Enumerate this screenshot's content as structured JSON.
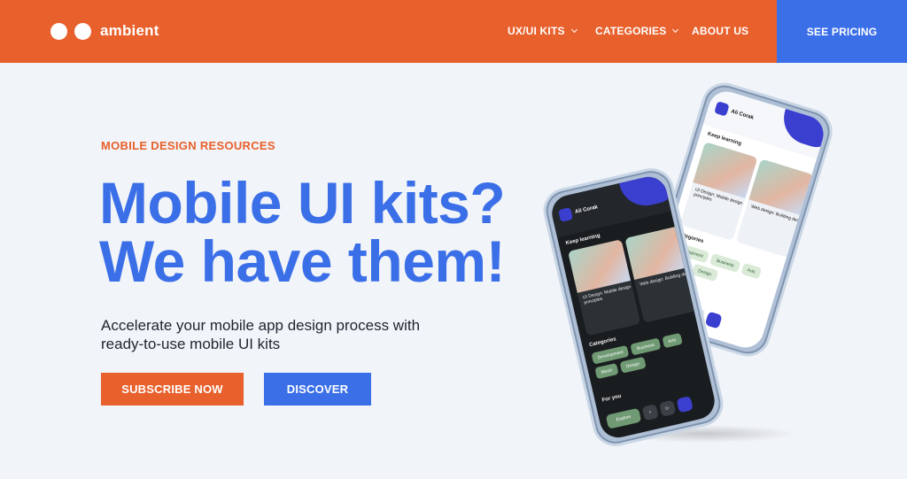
{
  "brand": {
    "name": "ambient"
  },
  "nav": {
    "items": [
      {
        "label": "UX/UI KITS",
        "has_dropdown": true
      },
      {
        "label": "CATEGORIES",
        "has_dropdown": true
      },
      {
        "label": "ABOUT US",
        "has_dropdown": false
      }
    ],
    "cta": "SEE PRICING"
  },
  "hero": {
    "eyebrow": "MOBILE DESIGN RESOURCES",
    "headline_line1": "Mobile UI kits?",
    "headline_line2": "We have them!",
    "subtext": "Accelerate your mobile app design process with ready-to-use mobile UI kits",
    "primary_button": "SUBSCRIBE NOW",
    "secondary_button": "DISCOVER"
  },
  "phone_screen": {
    "user_name": "Ali Corak",
    "keep_learning": "Keep learning",
    "card1_title": "UI Design: Mobile design principles",
    "card2_title": "Web design: Building desi",
    "categories_label": "Categories",
    "chips": [
      "Development",
      "Business",
      "Arts",
      "Music",
      "Design"
    ],
    "for_you": "For you",
    "explore": "Explore"
  },
  "colors": {
    "brand_orange": "#e8602c",
    "brand_blue": "#3b6fe8",
    "page_bg": "#f1f4f8"
  }
}
